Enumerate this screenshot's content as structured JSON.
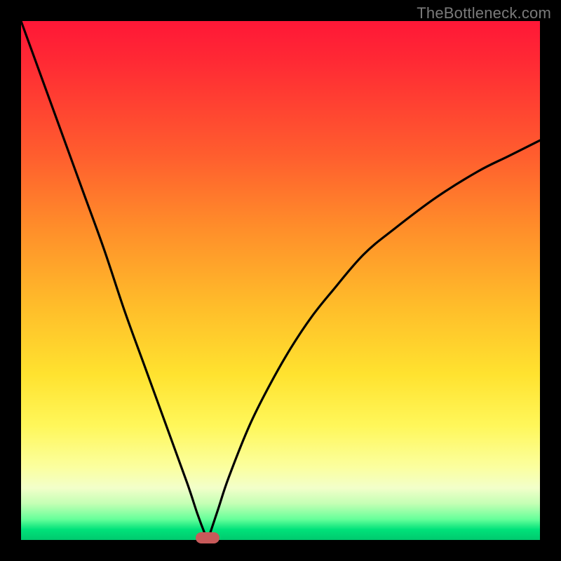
{
  "watermark": {
    "text": "TheBottleneck.com"
  },
  "colors": {
    "gradient_top": "#ff1737",
    "gradient_mid": "#ffe22f",
    "gradient_bottom": "#00c96e",
    "curve": "#000000",
    "marker": "#c85a5a",
    "frame_bg": "#000000"
  },
  "chart_data": {
    "type": "line",
    "title": "",
    "xlabel": "",
    "ylabel": "",
    "xlim": [
      0,
      100
    ],
    "ylim": [
      0,
      100
    ],
    "grid": false,
    "legend": false,
    "note": "V-shaped bottleneck curve; y≈0 at x≈36; background color encodes bottleneck percentage (green=0%, red=100%)",
    "minimum": {
      "x": 36,
      "y": 0
    },
    "series": [
      {
        "name": "left-branch",
        "x": [
          0,
          4,
          8,
          12,
          16,
          20,
          24,
          28,
          32,
          34,
          35.5,
          36
        ],
        "y": [
          100,
          89,
          78,
          67,
          56,
          44,
          33,
          22,
          11,
          5,
          1,
          0
        ]
      },
      {
        "name": "right-branch",
        "x": [
          36,
          38,
          40,
          44,
          48,
          52,
          56,
          60,
          66,
          72,
          80,
          88,
          94,
          100
        ],
        "y": [
          0,
          6,
          12,
          22,
          30,
          37,
          43,
          48,
          55,
          60,
          66,
          71,
          74,
          77
        ]
      }
    ],
    "marker": {
      "x": 36,
      "y": 0,
      "shape": "pill",
      "color": "#c85a5a"
    }
  }
}
